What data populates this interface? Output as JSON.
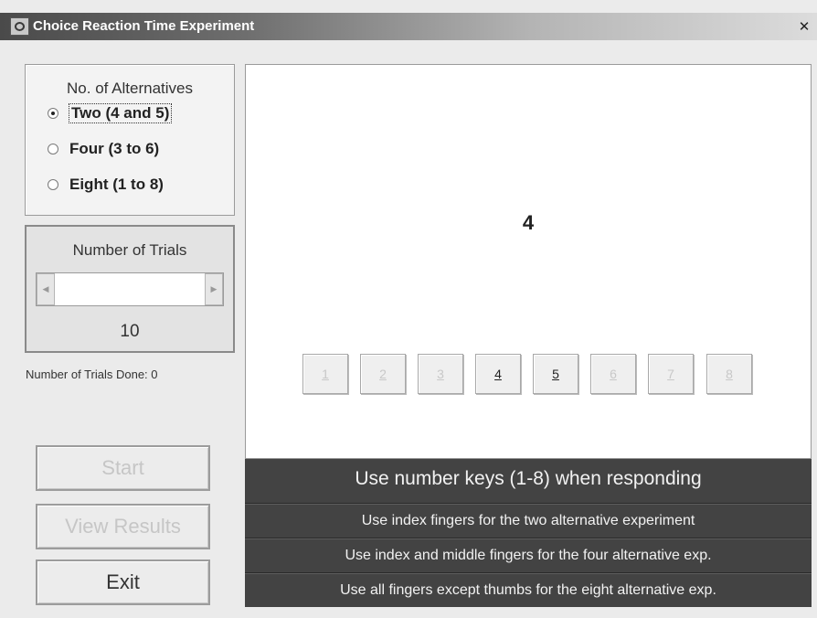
{
  "window": {
    "title": "Choice Reaction Time Experiment",
    "close_glyph": "✕",
    "icon": "app-icon"
  },
  "alternatives": {
    "title": "No. of Alternatives",
    "options": [
      {
        "label": "Two (4 and 5)",
        "checked": true
      },
      {
        "label": "Four (3 to 6)",
        "checked": false
      },
      {
        "label": "Eight (1 to 8)",
        "checked": false
      }
    ]
  },
  "trials": {
    "title": "Number of Trials",
    "left_arrow": "◀",
    "right_arrow": "▶",
    "value": "10",
    "done_text": "Number of Trials Done: 0"
  },
  "buttons": {
    "start": "Start",
    "view_results": "View Results",
    "exit": "Exit"
  },
  "display": {
    "stimulus": "4",
    "keys": [
      {
        "label": "1",
        "active": false
      },
      {
        "label": "2",
        "active": false
      },
      {
        "label": "3",
        "active": false
      },
      {
        "label": "4",
        "active": true
      },
      {
        "label": "5",
        "active": true
      },
      {
        "label": "6",
        "active": false
      },
      {
        "label": "7",
        "active": false
      },
      {
        "label": "8",
        "active": false
      }
    ]
  },
  "instructions": {
    "main": "Use number keys (1-8) when responding",
    "lines": [
      "Use index fingers for the two alternative experiment",
      "Use index and middle fingers for the four alternative exp.",
      "Use all fingers except thumbs for the eight alternative exp."
    ]
  },
  "colors": {
    "instruction_bg": "#434343",
    "window_bg": "#ebebeb",
    "display_bg": "#ffffff"
  }
}
